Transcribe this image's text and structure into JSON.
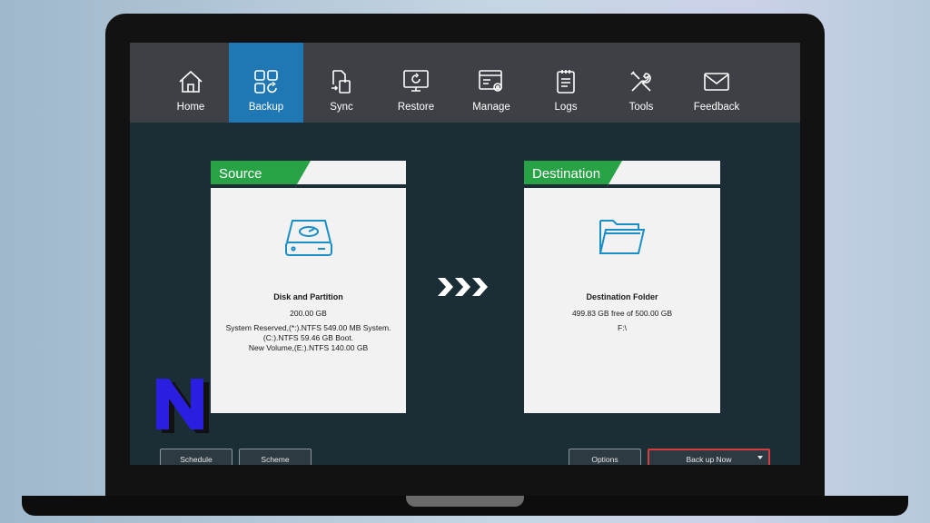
{
  "nav": {
    "items": [
      {
        "label": "Home",
        "icon": "home-icon"
      },
      {
        "label": "Backup",
        "icon": "backup-icon",
        "active": true
      },
      {
        "label": "Sync",
        "icon": "sync-icon"
      },
      {
        "label": "Restore",
        "icon": "restore-icon"
      },
      {
        "label": "Manage",
        "icon": "manage-icon"
      },
      {
        "label": "Logs",
        "icon": "logs-icon"
      },
      {
        "label": "Tools",
        "icon": "tools-icon"
      },
      {
        "label": "Feedback",
        "icon": "feedback-icon"
      }
    ]
  },
  "source": {
    "title": "Source",
    "icon": "disk-icon",
    "heading": "Disk and Partition",
    "size": "200.00 GB",
    "details": [
      "System Reserved,(*:).NTFS 549.00 MB System.",
      "(C:).NTFS 59.46 GB Boot.",
      "New Volume,(E:).NTFS 140.00 GB"
    ]
  },
  "destination": {
    "title": "Destination",
    "icon": "folder-icon",
    "heading": "Destination Folder",
    "free_space": "499.83 GB free of 500.00 GB",
    "path": "F:\\"
  },
  "buttons": {
    "schedule": "Schedule",
    "scheme": "Scheme",
    "options": "Options",
    "backup_now": "Back up Now"
  },
  "colors": {
    "accent_green": "#27a244",
    "active_tab": "#1f78b4",
    "content_bg": "#1b2d35",
    "nav_bg": "#3d4045",
    "icon_blue": "#1a8fc7",
    "primary_border": "#d33d3d"
  }
}
